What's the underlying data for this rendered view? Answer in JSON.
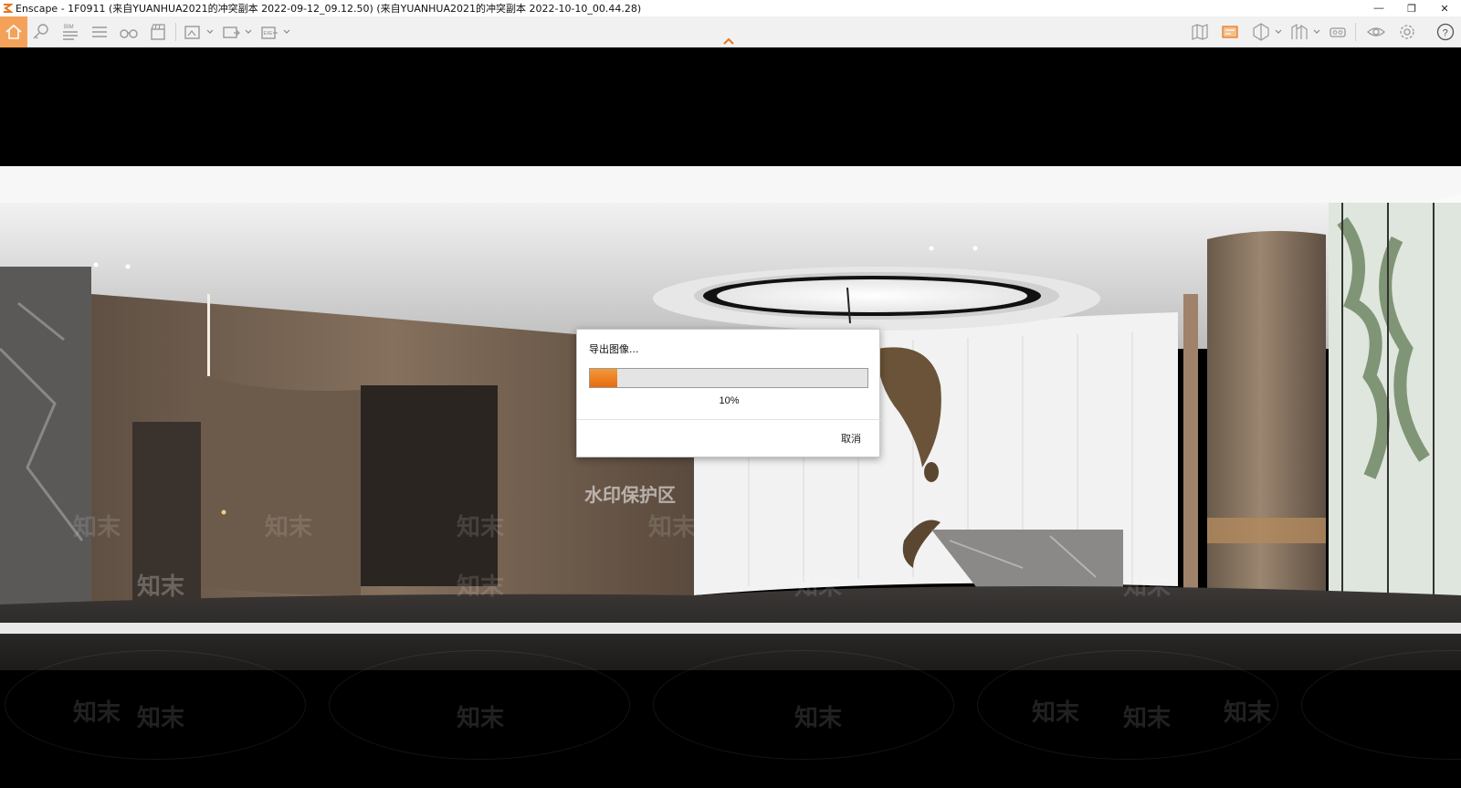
{
  "window": {
    "title": "Enscape - 1F0911 (来自YUANHUA2021的冲突副本 2022-09-12_09.12.50) (来自YUANHUA2021的冲突副本 2022-10-10_00.44.28)",
    "controls": [
      "—",
      "❐",
      "✕"
    ]
  },
  "toolbar": {
    "left_icons": [
      "home-icon",
      "view-management-icon",
      "bim-icon",
      "settings-list-icon",
      "binoculars-icon",
      "clapperboard-icon",
      "screenshot-icon",
      "export-panorama-icon",
      "export-exe-icon"
    ],
    "bim_label": "BIM",
    "exe_label": "EXE",
    "right_icons": [
      "map-icon",
      "mini-map-icon",
      "section-icon",
      "asset-library-icon",
      "vr-headset-icon",
      "visibility-icon",
      "gear-icon",
      "help-icon"
    ],
    "help_label": "?",
    "accent": "#f4a25a"
  },
  "dialog": {
    "title": "导出图像...",
    "progress_percent": 10,
    "progress_label": "10%",
    "cancel_label": "取消",
    "progress_color": "#ef7f22"
  },
  "watermark": {
    "protect_text": "水印保护区",
    "brand_text": "知末"
  }
}
